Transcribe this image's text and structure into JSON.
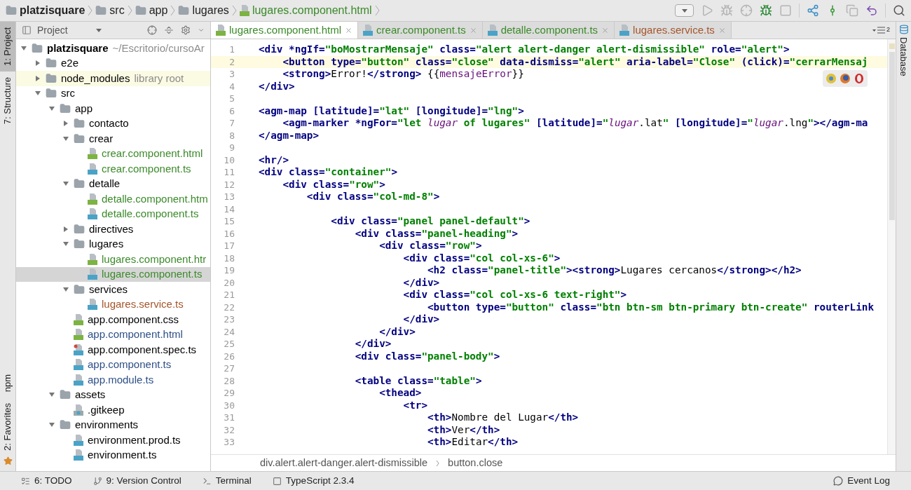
{
  "nav_bar": {
    "crumbs": [
      {
        "label": "platzisquare",
        "kind": "folder"
      },
      {
        "label": "src",
        "kind": "folder"
      },
      {
        "label": "app",
        "kind": "folder"
      },
      {
        "label": "lugares",
        "kind": "folder"
      },
      {
        "label": "lugares.component.html",
        "kind": "html"
      }
    ]
  },
  "left_strip": [
    {
      "label": "1: Project",
      "selected": true,
      "kind": "top"
    },
    {
      "label": "7: Structure",
      "selected": false,
      "kind": "top"
    },
    {
      "label": "npm",
      "selected": false,
      "kind": "bottom"
    },
    {
      "label": "2: Favorites",
      "selected": false,
      "kind": "bottom"
    }
  ],
  "right_strip": [
    {
      "label": "Database"
    }
  ],
  "project_panel": {
    "title": "Project",
    "tree": [
      {
        "name": "platzisquare",
        "hint": "~/Escritorio/cursoAr",
        "kind": "folder",
        "expanded": true,
        "selected": false,
        "children": [
          {
            "name": "e2e",
            "kind": "folder",
            "expanded": false,
            "selected": false
          },
          {
            "name": "node_modules",
            "hint": "library root",
            "kind": "folder",
            "expanded": false,
            "selected": false,
            "highlighted": true
          },
          {
            "name": "src",
            "kind": "folder",
            "expanded": true,
            "selected": false,
            "children": [
              {
                "name": "app",
                "kind": "folder",
                "expanded": true,
                "selected": false,
                "children": [
                  {
                    "name": "contacto",
                    "kind": "folder",
                    "expanded": false,
                    "selected": false
                  },
                  {
                    "name": "crear",
                    "kind": "folder",
                    "expanded": true,
                    "selected": false,
                    "children": [
                      {
                        "name": "crear.component.html",
                        "kind": "html",
                        "color": "#3b8a2a",
                        "selected": false
                      },
                      {
                        "name": "crear.component.ts",
                        "kind": "ts",
                        "color": "#3b8a2a",
                        "selected": false
                      }
                    ]
                  },
                  {
                    "name": "detalle",
                    "kind": "folder",
                    "expanded": true,
                    "selected": false,
                    "children": [
                      {
                        "name": "detalle.component.htm",
                        "kind": "html",
                        "color": "#3b8a2a",
                        "selected": false
                      },
                      {
                        "name": "detalle.component.ts",
                        "kind": "ts",
                        "color": "#3b8a2a",
                        "selected": false
                      }
                    ]
                  },
                  {
                    "name": "directives",
                    "kind": "folder",
                    "expanded": false,
                    "selected": false
                  },
                  {
                    "name": "lugares",
                    "kind": "folder",
                    "expanded": true,
                    "selected": false,
                    "children": [
                      {
                        "name": "lugares.component.htr",
                        "kind": "html",
                        "color": "#3b8a2a",
                        "selected": false
                      },
                      {
                        "name": "lugares.component.ts",
                        "kind": "ts",
                        "color": "#3b8a2a",
                        "selected": true
                      }
                    ]
                  },
                  {
                    "name": "services",
                    "kind": "folder",
                    "expanded": true,
                    "selected": false,
                    "children": [
                      {
                        "name": "lugares.service.ts",
                        "kind": "ts",
                        "color": "#a5552a",
                        "selected": false
                      }
                    ]
                  },
                  {
                    "name": "app.component.css",
                    "kind": "css",
                    "color": "#000000",
                    "selected": false
                  },
                  {
                    "name": "app.component.html",
                    "kind": "html",
                    "color": "#2d4f86",
                    "selected": false
                  },
                  {
                    "name": "app.component.spec.ts",
                    "kind": "spec",
                    "color": "#000000",
                    "selected": false
                  },
                  {
                    "name": "app.component.ts",
                    "kind": "ts",
                    "color": "#2d4f86",
                    "selected": false
                  },
                  {
                    "name": "app.module.ts",
                    "kind": "ts",
                    "color": "#2d4f86",
                    "selected": false
                  }
                ]
              },
              {
                "name": "assets",
                "kind": "folder",
                "expanded": true,
                "selected": false,
                "children": [
                  {
                    "name": ".gitkeep",
                    "kind": "unknown",
                    "color": "#000000",
                    "selected": false
                  }
                ]
              },
              {
                "name": "environments",
                "kind": "folder",
                "expanded": true,
                "selected": false,
                "children": [
                  {
                    "name": "environment.prod.ts",
                    "kind": "ts",
                    "color": "#000000",
                    "selected": false
                  },
                  {
                    "name": "environment.ts",
                    "kind": "ts",
                    "color": "#000000",
                    "selected": false
                  }
                ]
              }
            ]
          }
        ]
      }
    ]
  },
  "editor": {
    "tabs": [
      {
        "label": "lugares.component.html",
        "kind": "html",
        "color": "#3b8a2a",
        "selected": true
      },
      {
        "label": "crear.component.ts",
        "kind": "ts",
        "color": "#3b8a2a",
        "selected": false
      },
      {
        "label": "detalle.component.ts",
        "kind": "ts",
        "color": "#3b8a2a",
        "selected": false
      },
      {
        "label": "lugares.service.ts",
        "kind": "ts",
        "color": "#a5552a",
        "selected": false
      }
    ],
    "tab_count": "2",
    "lines": [
      {
        "number": "1",
        "current": false,
        "tokens": [
          {
            "kind": "tag",
            "text": "<div *ngIf="
          },
          {
            "kind": "str",
            "text": "\"boMostrarMensaje\""
          },
          {
            "kind": "tag",
            "text": " class="
          },
          {
            "kind": "str",
            "text": "\"alert alert-danger alert-dismissible\""
          },
          {
            "kind": "tag",
            "text": " role="
          },
          {
            "kind": "str",
            "text": "\"alert\""
          },
          {
            "kind": "tag",
            "text": ">"
          }
        ]
      },
      {
        "number": "2",
        "current": true,
        "tokens": [
          {
            "kind": "tag",
            "text": "    <button type="
          },
          {
            "kind": "str",
            "text": "\"button\""
          },
          {
            "kind": "tag",
            "text": " class="
          },
          {
            "kind": "str",
            "text": "\"close\""
          },
          {
            "kind": "tag",
            "text": " data-dismiss="
          },
          {
            "kind": "str",
            "text": "\"alert\""
          },
          {
            "kind": "tag",
            "text": " aria-label="
          },
          {
            "kind": "str",
            "text": "\"Close\""
          },
          {
            "kind": "tag",
            "text": " (click)="
          },
          {
            "kind": "str",
            "text": "\"cerrarMensaj"
          }
        ]
      },
      {
        "number": "3",
        "current": false,
        "tokens": [
          {
            "kind": "tag",
            "text": "    <strong>"
          },
          {
            "kind": "text",
            "text": "Error!"
          },
          {
            "kind": "tag",
            "text": "</strong>"
          },
          {
            "kind": "text",
            "text": " {{"
          },
          {
            "kind": "expr",
            "text": "mensajeError"
          },
          {
            "kind": "text",
            "text": "}}"
          }
        ]
      },
      {
        "number": "4",
        "current": false,
        "tokens": [
          {
            "kind": "tag",
            "text": "</div>"
          }
        ]
      },
      {
        "number": "5",
        "current": false
      },
      {
        "number": "6",
        "current": false,
        "tokens": [
          {
            "kind": "tag",
            "text": "<agm-map [latitude]="
          },
          {
            "kind": "str",
            "text": "\"lat\""
          },
          {
            "kind": "tag",
            "text": " [longitude]="
          },
          {
            "kind": "str",
            "text": "\"lng\""
          },
          {
            "kind": "tag",
            "text": ">"
          }
        ]
      },
      {
        "number": "7",
        "current": false,
        "tokens": [
          {
            "kind": "tag",
            "text": "    <agm-marker *ngFor="
          },
          {
            "kind": "str",
            "text": "\"let "
          },
          {
            "kind": "var",
            "text": "lugar"
          },
          {
            "kind": "str",
            "text": " of lugares\""
          },
          {
            "kind": "tag",
            "text": " [latitude]="
          },
          {
            "kind": "str",
            "text": "\""
          },
          {
            "kind": "var",
            "text": "lugar"
          },
          {
            "kind": "text",
            "text": ".lat"
          },
          {
            "kind": "str",
            "text": "\""
          },
          {
            "kind": "tag",
            "text": " [longitude]="
          },
          {
            "kind": "str",
            "text": "\""
          },
          {
            "kind": "var",
            "text": "lugar"
          },
          {
            "kind": "text",
            "text": ".lng"
          },
          {
            "kind": "str",
            "text": "\""
          },
          {
            "kind": "tag",
            "text": "></agm-ma"
          }
        ]
      },
      {
        "number": "8",
        "current": false,
        "tokens": [
          {
            "kind": "tag",
            "text": "</agm-map>"
          }
        ]
      },
      {
        "number": "9",
        "current": false
      },
      {
        "number": "10",
        "current": false,
        "tokens": [
          {
            "kind": "tag",
            "text": "<hr/>"
          }
        ]
      },
      {
        "number": "11",
        "current": false,
        "tokens": [
          {
            "kind": "tag",
            "text": "<div class="
          },
          {
            "kind": "str",
            "text": "\"container\""
          },
          {
            "kind": "tag",
            "text": ">"
          }
        ]
      },
      {
        "number": "12",
        "current": false,
        "tokens": [
          {
            "kind": "tag",
            "text": "    <div class="
          },
          {
            "kind": "str",
            "text": "\"row\""
          },
          {
            "kind": "tag",
            "text": ">"
          }
        ]
      },
      {
        "number": "13",
        "current": false,
        "tokens": [
          {
            "kind": "tag",
            "text": "        <div class="
          },
          {
            "kind": "str",
            "text": "\"col-md-8\""
          },
          {
            "kind": "tag",
            "text": ">"
          }
        ]
      },
      {
        "number": "14",
        "current": false
      },
      {
        "number": "15",
        "current": false,
        "tokens": [
          {
            "kind": "tag",
            "text": "            <div class="
          },
          {
            "kind": "str",
            "text": "\"panel panel-default\""
          },
          {
            "kind": "tag",
            "text": ">"
          }
        ]
      },
      {
        "number": "16",
        "current": false,
        "tokens": [
          {
            "kind": "tag",
            "text": "                <div class="
          },
          {
            "kind": "str",
            "text": "\"panel-heading\""
          },
          {
            "kind": "tag",
            "text": ">"
          }
        ]
      },
      {
        "number": "17",
        "current": false,
        "tokens": [
          {
            "kind": "tag",
            "text": "                    <div class="
          },
          {
            "kind": "str",
            "text": "\"row\""
          },
          {
            "kind": "tag",
            "text": ">"
          }
        ]
      },
      {
        "number": "18",
        "current": false,
        "tokens": [
          {
            "kind": "tag",
            "text": "                        <div class="
          },
          {
            "kind": "str",
            "text": "\"col col-xs-6\""
          },
          {
            "kind": "tag",
            "text": ">"
          }
        ]
      },
      {
        "number": "19",
        "current": false,
        "tokens": [
          {
            "kind": "tag",
            "text": "                            <h2 class="
          },
          {
            "kind": "str",
            "text": "\"panel-title\""
          },
          {
            "kind": "tag",
            "text": "><strong>"
          },
          {
            "kind": "text",
            "text": "Lugares cercanos"
          },
          {
            "kind": "tag",
            "text": "</strong></h2>"
          }
        ]
      },
      {
        "number": "20",
        "current": false,
        "tokens": [
          {
            "kind": "tag",
            "text": "                        </div>"
          }
        ]
      },
      {
        "number": "21",
        "current": false,
        "tokens": [
          {
            "kind": "tag",
            "text": "                        <div class="
          },
          {
            "kind": "str",
            "text": "\"col col-xs-6 text-right\""
          },
          {
            "kind": "tag",
            "text": ">"
          }
        ]
      },
      {
        "number": "22",
        "current": false,
        "tokens": [
          {
            "kind": "tag",
            "text": "                            <button type="
          },
          {
            "kind": "str",
            "text": "\"button\""
          },
          {
            "kind": "tag",
            "text": " class="
          },
          {
            "kind": "str",
            "text": "\"btn btn-sm btn-primary btn-create\""
          },
          {
            "kind": "tag",
            "text": " routerLink"
          }
        ]
      },
      {
        "number": "23",
        "current": false,
        "tokens": [
          {
            "kind": "tag",
            "text": "                        </div>"
          }
        ]
      },
      {
        "number": "24",
        "current": false,
        "tokens": [
          {
            "kind": "tag",
            "text": "                    </div>"
          }
        ]
      },
      {
        "number": "25",
        "current": false,
        "tokens": [
          {
            "kind": "tag",
            "text": "                </div>"
          }
        ]
      },
      {
        "number": "26",
        "current": false,
        "tokens": [
          {
            "kind": "tag",
            "text": "                <div class="
          },
          {
            "kind": "str",
            "text": "\"panel-body\""
          },
          {
            "kind": "tag",
            "text": ">"
          }
        ]
      },
      {
        "number": "27",
        "current": false
      },
      {
        "number": "28",
        "current": false,
        "tokens": [
          {
            "kind": "tag",
            "text": "                <table class="
          },
          {
            "kind": "str",
            "text": "\"table\""
          },
          {
            "kind": "tag",
            "text": ">"
          }
        ]
      },
      {
        "number": "29",
        "current": false,
        "tokens": [
          {
            "kind": "tag",
            "text": "                    <thead>"
          }
        ]
      },
      {
        "number": "30",
        "current": false,
        "tokens": [
          {
            "kind": "tag",
            "text": "                        <tr>"
          }
        ]
      },
      {
        "number": "31",
        "current": false,
        "tokens": [
          {
            "kind": "tag",
            "text": "                            <th>"
          },
          {
            "kind": "text",
            "text": "Nombre del Lugar"
          },
          {
            "kind": "tag",
            "text": "</th>"
          }
        ]
      },
      {
        "number": "32",
        "current": false,
        "tokens": [
          {
            "kind": "tag",
            "text": "                            <th>"
          },
          {
            "kind": "text",
            "text": "Ver"
          },
          {
            "kind": "tag",
            "text": "</th>"
          }
        ]
      },
      {
        "number": "33",
        "current": false,
        "tokens": [
          {
            "kind": "tag",
            "text": "                            <th>"
          },
          {
            "kind": "text",
            "text": "Editar"
          },
          {
            "kind": "tag",
            "text": "</th>"
          }
        ]
      }
    ],
    "breadcrumb": [
      "div.alert.alert-danger.alert-dismissible",
      "button.close"
    ]
  },
  "status_bar": {
    "left": [
      {
        "label": "6: TODO",
        "kind": "todo"
      },
      {
        "label": "9: Version Control",
        "kind": "vcs"
      },
      {
        "label": "Terminal",
        "kind": "terminal"
      },
      {
        "label": "TypeScript 2.3.4",
        "kind": "typescript"
      }
    ],
    "right": [
      {
        "label": "Event Log",
        "kind": "log"
      }
    ]
  }
}
